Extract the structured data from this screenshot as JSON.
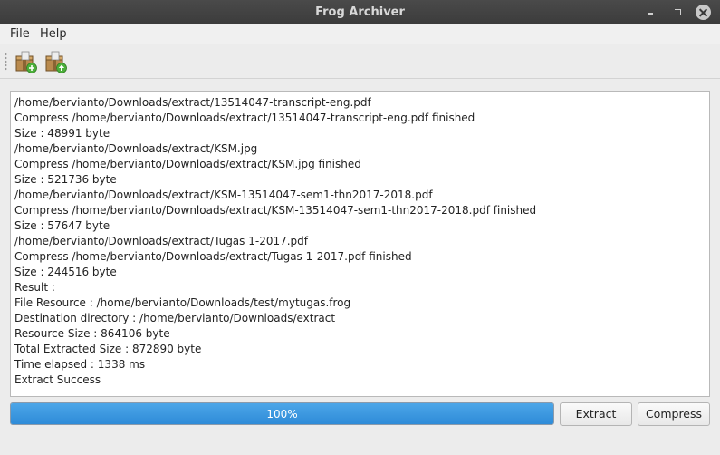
{
  "window": {
    "title": "Frog Archiver"
  },
  "menu": {
    "file": "File",
    "help": "Help"
  },
  "toolbar": {
    "buttons": [
      {
        "icon": "archive-add-icon"
      },
      {
        "icon": "archive-extract-icon"
      }
    ]
  },
  "output": {
    "lines": [
      "/home/bervianto/Downloads/extract/13514047-transcript-eng.pdf",
      "Compress /home/bervianto/Downloads/extract/13514047-transcript-eng.pdf finished",
      "Size : 48991 byte",
      "/home/bervianto/Downloads/extract/KSM.jpg",
      "Compress /home/bervianto/Downloads/extract/KSM.jpg finished",
      "Size : 521736 byte",
      "/home/bervianto/Downloads/extract/KSM-13514047-sem1-thn2017-2018.pdf",
      "Compress /home/bervianto/Downloads/extract/KSM-13514047-sem1-thn2017-2018.pdf finished",
      "Size : 57647 byte",
      "/home/bervianto/Downloads/extract/Tugas 1-2017.pdf",
      "Compress /home/bervianto/Downloads/extract/Tugas 1-2017.pdf finished",
      "Size : 244516 byte",
      "Result :",
      "File Resource : /home/bervianto/Downloads/test/mytugas.frog",
      "Destination directory : /home/bervianto/Downloads/extract",
      "Resource Size : 864106 byte",
      "Total Extracted Size : 872890 byte",
      "Time elapsed : 1338 ms",
      "Extract Success"
    ]
  },
  "progress": {
    "value": 100,
    "label": "100%"
  },
  "buttons": {
    "extract": "Extract",
    "compress": "Compress"
  },
  "colors": {
    "titlebar": "#3c3c3c",
    "progress_fill": "#2e8bd8",
    "close_button": "#c9c9c9"
  }
}
